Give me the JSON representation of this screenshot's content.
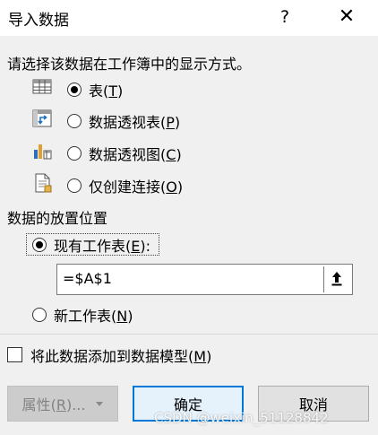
{
  "dialog": {
    "title": "导入数据",
    "help_glyph": "?",
    "close_glyph": "✕"
  },
  "view_section": {
    "prompt": "请选择该数据在工作簿中的显示方式。",
    "options": [
      {
        "label": "表",
        "key": "T",
        "icon": "table-icon",
        "checked": true
      },
      {
        "label": "数据透视表",
        "key": "P",
        "icon": "pivot-table-icon",
        "checked": false
      },
      {
        "label": "数据透视图",
        "key": "C",
        "icon": "pivot-chart-icon",
        "checked": false
      },
      {
        "label": "仅创建连接",
        "key": "O",
        "icon": "connection-only-icon",
        "checked": false
      }
    ]
  },
  "placement_section": {
    "heading": "数据的放置位置",
    "existing_label": "现有工作表",
    "existing_key": "E",
    "existing_suffix": ":",
    "existing_checked": true,
    "range_value": "=$A$1",
    "new_label": "新工作表",
    "new_key": "N",
    "new_checked": false
  },
  "data_model": {
    "label": "将此数据添加到数据模型",
    "key": "M",
    "checked": false
  },
  "buttons": {
    "properties": "属性",
    "properties_key": "R",
    "properties_suffix": "...",
    "ok": "确定",
    "cancel": "取消"
  },
  "watermark": "CSDN @weixin_51128842",
  "colors": {
    "accent": "#0078d7",
    "background": "#f0f0f0"
  }
}
